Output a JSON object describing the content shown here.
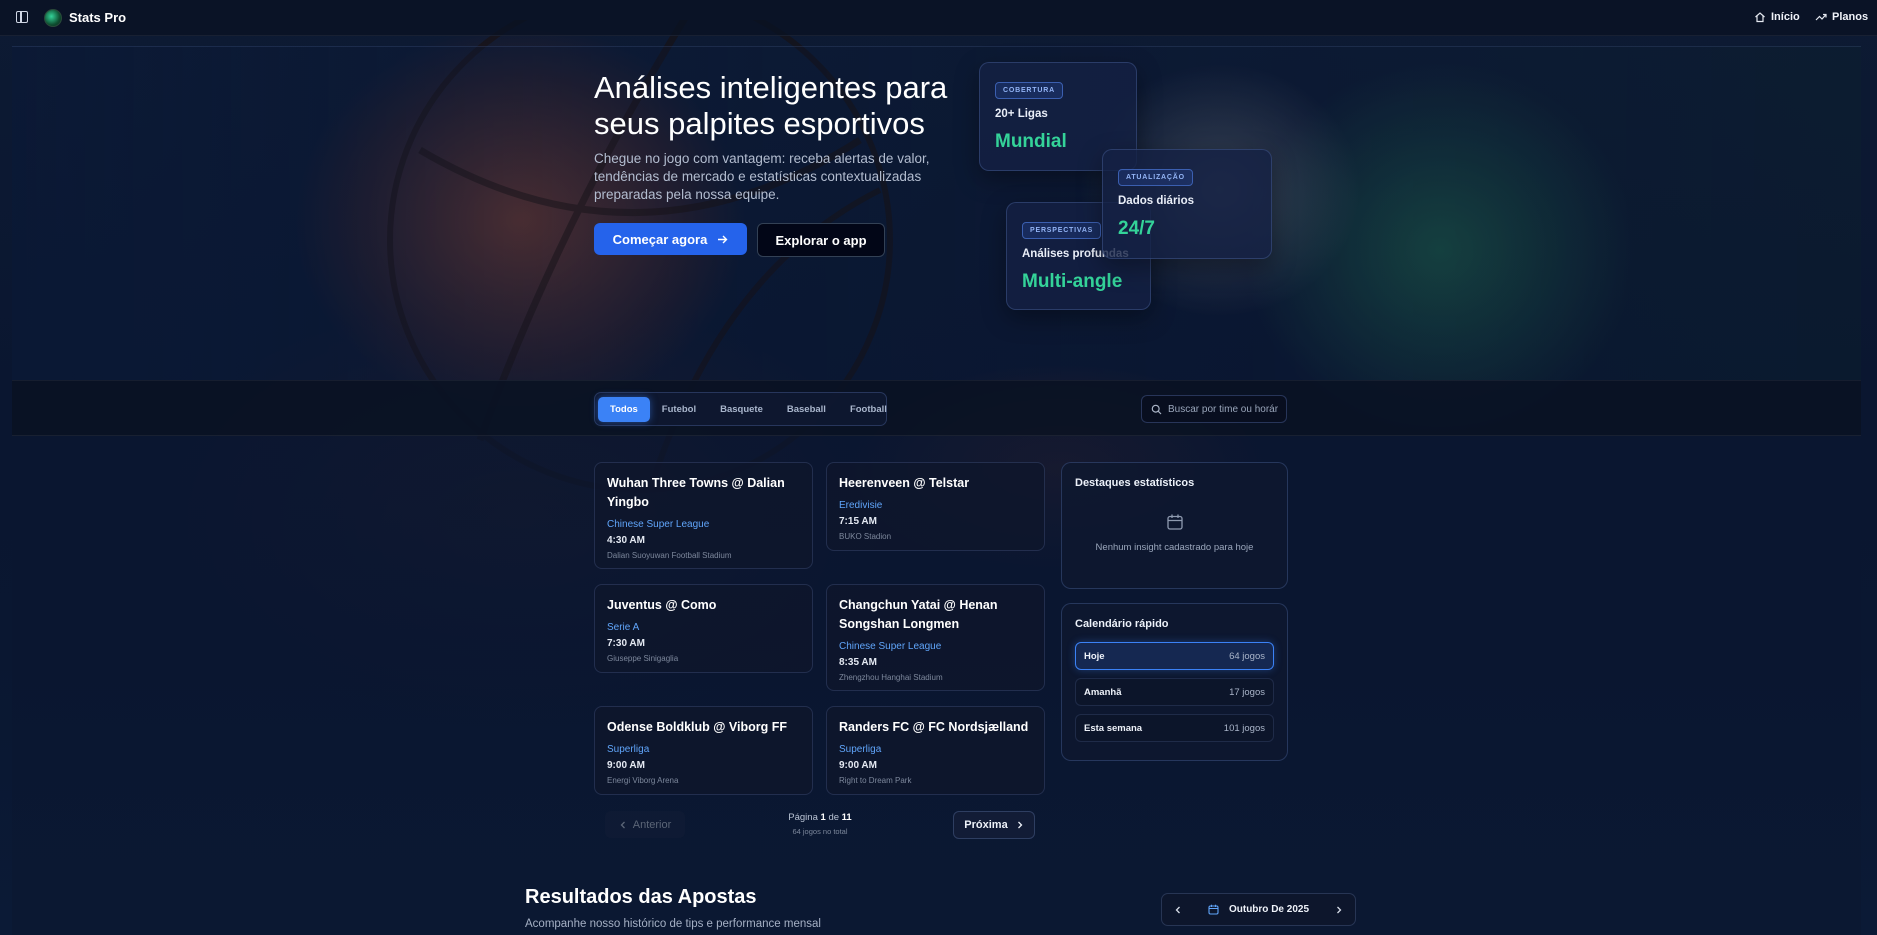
{
  "app": {
    "brand": "Stats Pro"
  },
  "nav": {
    "home_label": "Início",
    "plans_label": "Planos"
  },
  "hero": {
    "title": "Análises inteligentes para seus palpites esportivos",
    "subtitle": "Chegue no jogo com vantagem: receba alertas de valor, tendências de mercado e estatísticas contextualizadas preparadas pela nossa equipe.",
    "cta_primary": "Começar agora",
    "cta_secondary": "Explorar o app"
  },
  "stats": [
    {
      "badge": "COBERTURA",
      "label": "20+ Ligas",
      "value": "Mundial"
    },
    {
      "badge": "ATUALIZAÇÃO",
      "label": "Dados diários",
      "value": "24/7"
    },
    {
      "badge": "PERSPECTIVAS",
      "label": "Análises profundas",
      "value": "Multi-angle"
    }
  ],
  "filters": {
    "tabs": [
      "Todos",
      "Futebol",
      "Basquete",
      "Baseball",
      "Football"
    ],
    "active_tab": "Todos",
    "search_placeholder": "Buscar por time ou horário"
  },
  "games": [
    {
      "title": "Wuhan Three Towns @ Dalian Yingbo",
      "league": "Chinese Super League",
      "time": "4:30 AM",
      "venue": "Dalian Suoyuwan Football Stadium"
    },
    {
      "title": "Heerenveen @ Telstar",
      "league": "Eredivisie",
      "time": "7:15 AM",
      "venue": "BUKO Stadion"
    },
    {
      "title": "Juventus @ Como",
      "league": "Serie A",
      "time": "7:30 AM",
      "venue": "Giuseppe Sinigaglia"
    },
    {
      "title": "Changchun Yatai @ Henan Songshan Longmen",
      "league": "Chinese Super League",
      "time": "8:35 AM",
      "venue": "Zhengzhou Hanghai Stadium"
    },
    {
      "title": "Odense Boldklub @ Viborg FF",
      "league": "Superliga",
      "time": "9:00 AM",
      "venue": "Energi Viborg Arena"
    },
    {
      "title": "Randers FC @ FC Nordsjælland",
      "league": "Superliga",
      "time": "9:00 AM",
      "venue": "Right to Dream Park"
    }
  ],
  "insights": {
    "title": "Destaques estatísticos",
    "empty": "Nenhum insight cadastrado para hoje"
  },
  "calendar": {
    "title": "Calendário rápido",
    "rows": [
      {
        "label": "Hoje",
        "count": "64 jogos"
      },
      {
        "label": "Amanhã",
        "count": "17 jogos"
      },
      {
        "label": "Esta semana",
        "count": "101 jogos"
      }
    ]
  },
  "pagination": {
    "prev": "Anterior",
    "next": "Próxima",
    "page_word": "Página",
    "current": "1",
    "of_word": "de",
    "total_pages": "11",
    "total_games": "64 jogos no total"
  },
  "results": {
    "title": "Resultados das Apostas",
    "subtitle": "Acompanhe nosso histórico de tips e performance mensal",
    "month": "Outubro De 2025"
  },
  "colors": {
    "accent": "#3b82f6",
    "primary_button": "#2563eb",
    "stat_value": "#34d399",
    "league": "#60a5fa"
  }
}
